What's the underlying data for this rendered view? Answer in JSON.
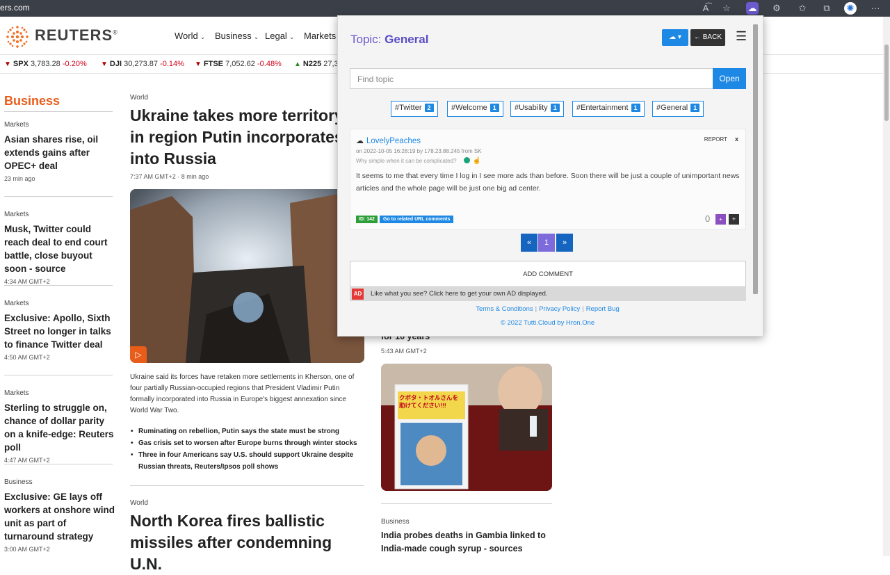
{
  "browser": {
    "url": "ers.com",
    "toolbar_icons": [
      "read-aloud-icon",
      "favorite-add-icon",
      "tutti-extension-icon",
      "extensions-icon",
      "favorites-icon",
      "collections-icon",
      "profile-icon",
      "more-icon"
    ]
  },
  "site": {
    "logo": "REUTERS",
    "logo_mark": "®",
    "nav": [
      "World",
      "Business",
      "Legal",
      "Markets"
    ]
  },
  "ticker": [
    {
      "symbol": "SPX",
      "value": "3,783.28",
      "change": "-0.20%",
      "dir": "down"
    },
    {
      "symbol": "DJI",
      "value": "30,273.87",
      "change": "-0.14%",
      "dir": "down"
    },
    {
      "symbol": "FTSE",
      "value": "7,052.62",
      "change": "-0.48%",
      "dir": "down"
    },
    {
      "symbol": "N225",
      "value": "27,3",
      "change": "",
      "dir": "up"
    }
  ],
  "left": {
    "section": "Business",
    "stories": [
      {
        "kicker": "Markets",
        "head": "Asian shares rise, oil extends gains after OPEC+ deal",
        "time": "23 min ago"
      },
      {
        "kicker": "Markets",
        "head": "Musk, Twitter could reach deal to end court battle, close buyout soon - source",
        "time": "4:34 AM GMT+2"
      },
      {
        "kicker": "Markets",
        "head": "Exclusive: Apollo, Sixth Street no longer in talks to finance Twitter deal",
        "time": "4:50 AM GMT+2"
      },
      {
        "kicker": "Markets",
        "head": "Sterling to struggle on, chance of dollar parity on a knife-edge: Reuters poll",
        "time": "4:47 AM GMT+2"
      },
      {
        "kicker": "Business",
        "head": "Exclusive: GE lays off workers at onshore wind unit as part of turnaround strategy",
        "time": "3:00 AM GMT+2"
      }
    ]
  },
  "center": {
    "kicker": "World",
    "head": "Ukraine takes more territory in region Putin incorporates into Russia",
    "time": "7:37 AM GMT+2 · 8 min ago",
    "summary": "Ukraine said its forces have retaken more settlements in Kherson, one of four partially Russian-occupied regions that President Vladimir Putin formally incorporated into Russia in Europe's biggest annexation since World War Two.",
    "bullets": [
      "Ruminating on rebellion, Putin says the state must be strong",
      "Gas crisis set to worsen after Europe burns through winter stocks",
      "Three in four Americans say U.S. should support Ukraine despite Russian threats, Reuters/Ipsos poll shows"
    ],
    "second_kicker": "World",
    "second_head": "North Korea fires ballistic missiles after condemning U.N."
  },
  "right": {
    "partial_head": "for 10 years",
    "time": "5:43 AM GMT+2",
    "image_sign": "クボタ・トオルさんを 助けてください!!!",
    "kicker": "Business",
    "head": "India probes deaths in Gambia linked to India-made cough syrup - sources"
  },
  "popup": {
    "title_prefix": "Topic:",
    "title_topic": "General",
    "back_label": "← BACK",
    "search_placeholder": "Find topic",
    "open_label": "Open",
    "tags": [
      {
        "label": "#Twitter",
        "count": "2"
      },
      {
        "label": "#Welcome",
        "count": "1"
      },
      {
        "label": "#Usability",
        "count": "1"
      },
      {
        "label": "#Entertainment",
        "count": "1"
      },
      {
        "label": "#General",
        "count": "1"
      }
    ],
    "comment": {
      "user": "LovelyPeaches",
      "meta": "on 2022-10-05 16:28:19 by 178.23.88.245 from SK",
      "signature": "Why simple when it can be complicated?",
      "report": "REPORT",
      "close": "x",
      "body": "It seems to me that every time I log in I see more ads than before. Soon there will be just a couple of unimportant news articles and the whole page will be just one big ad center.",
      "id": "ID: 142",
      "related": "Go to related URL comments",
      "score": "0",
      "up": "+",
      "down": "+"
    },
    "pagination": {
      "prev": "«",
      "current": "1",
      "next": "»"
    },
    "add_comment": "ADD COMMENT",
    "ad_badge": "AD",
    "ad_text": "Like what you see? Click here to get your own AD displayed.",
    "links": [
      "Terms & Conditions",
      "Privacy Policy",
      "Report Bug"
    ],
    "copyright": "© 2022 Tutti.Cloud by Hron.One"
  }
}
